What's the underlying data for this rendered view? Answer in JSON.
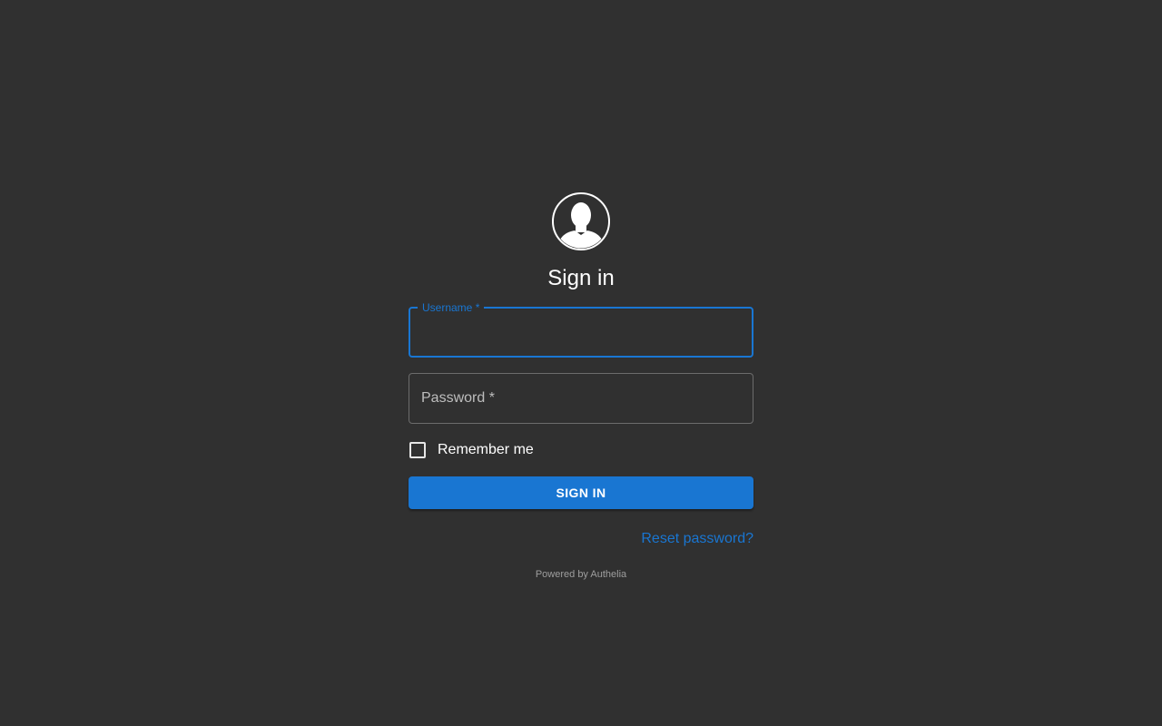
{
  "avatar": {
    "icon": "user-silhouette-icon"
  },
  "title": "Sign in",
  "form": {
    "username": {
      "label": "Username *",
      "value": ""
    },
    "password": {
      "label": "Password *",
      "value": ""
    },
    "remember_me": {
      "label": "Remember me",
      "checked": false
    },
    "submit_label": "SIGN IN",
    "reset_link": "Reset password?"
  },
  "footer": {
    "powered_by": "Powered by Authelia"
  },
  "colors": {
    "background": "#303030",
    "accent": "#1976d2",
    "text": "#ffffff",
    "muted": "#9e9e9e"
  }
}
